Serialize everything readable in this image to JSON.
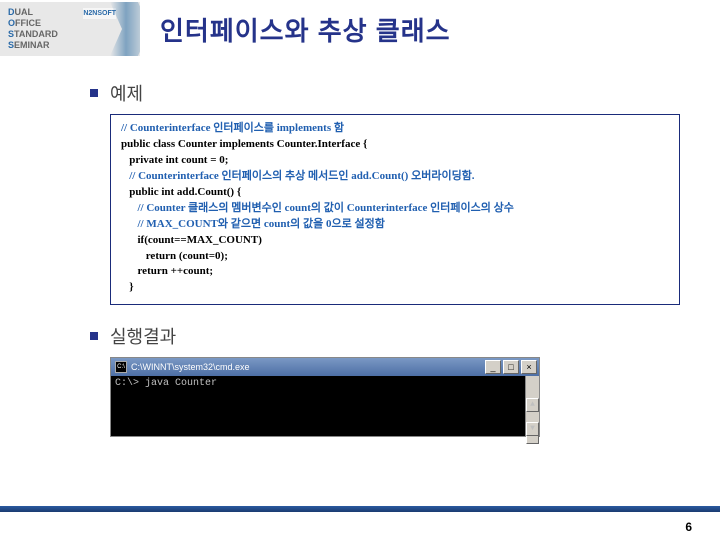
{
  "logo": {
    "l1a": "D",
    "l1b": "UAL",
    "l2a": "O",
    "l2b": "FFICE",
    "l3a": "S",
    "l3b": "TANDARD",
    "l4a": "S",
    "l4b": "EMINAR",
    "brand": "N2NSOFT"
  },
  "title": "인터페이스와 추상 클래스",
  "sections": {
    "example": "예제",
    "result": "실행결과"
  },
  "code": {
    "c1": "// Counterinterface 인터페이스를 implements 함",
    "p1": "public class Counter implements Counter.Interface {",
    "p2": "   private int count = 0;",
    "c2": "   // Counterinterface 인터페이스의 추상 메서드인 add.Count() 오버라이딩함.",
    "p3": "   public int add.Count() {",
    "c3": "      // Counter 클래스의 멤버변수인 count의 값이 Counterinterface 인터페이스의 상수",
    "c4": "      // MAX_COUNT와 같으면 count의 값을 0으로 설정함",
    "p4": "      if(count==MAX_COUNT)",
    "p5": "         return (count=0);",
    "p6": "      return ++count;",
    "p7": "   }"
  },
  "console": {
    "title": "C:\\WINNT\\system32\\cmd.exe",
    "line1": "C:\\> java Counter",
    "btn_min": "_",
    "btn_max": "□",
    "btn_close": "×",
    "sb_up": "▲",
    "sb_down": "▼"
  },
  "page": "6"
}
